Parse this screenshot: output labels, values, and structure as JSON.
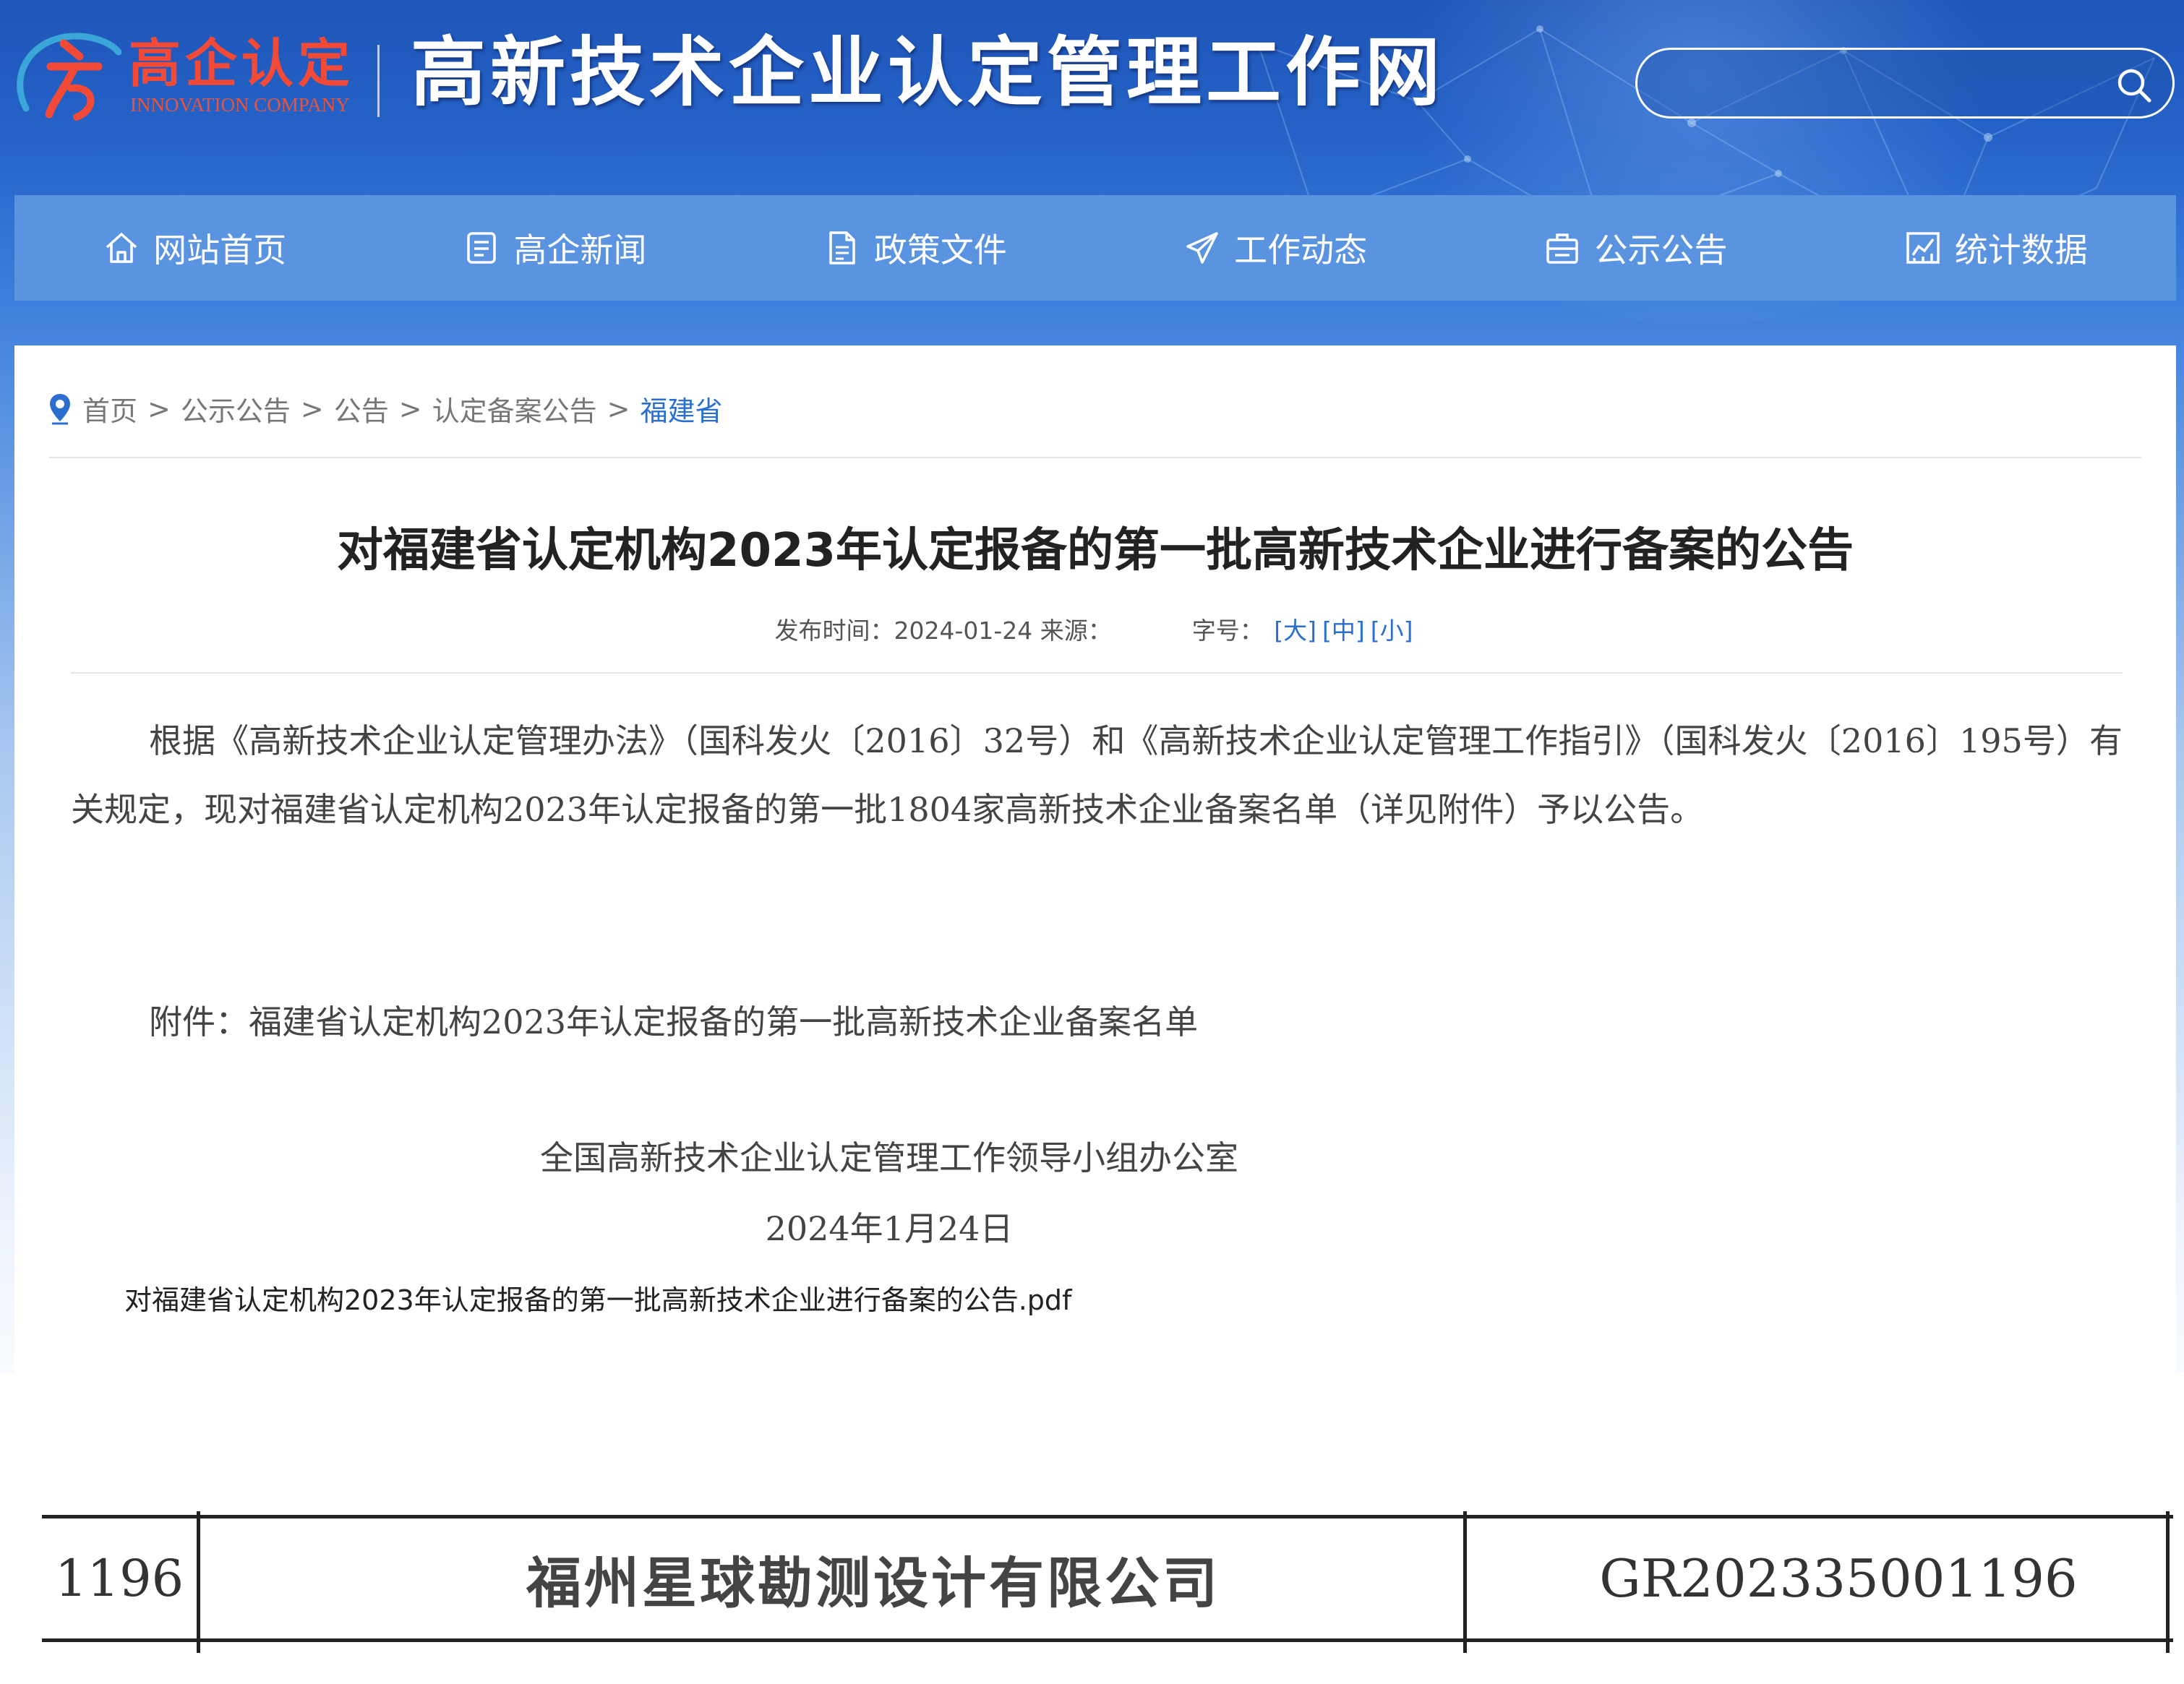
{
  "header": {
    "logo_cn": "高企认定",
    "logo_en": "INNOVATION COMPANY",
    "site_title": "高新技术企业认定管理工作网",
    "search": {
      "value": "",
      "placeholder": ""
    }
  },
  "nav": {
    "items": [
      {
        "label": "网站首页",
        "icon": "home-icon"
      },
      {
        "label": "高企新闻",
        "icon": "news-icon"
      },
      {
        "label": "政策文件",
        "icon": "document-icon"
      },
      {
        "label": "工作动态",
        "icon": "send-icon"
      },
      {
        "label": "公示公告",
        "icon": "briefcase-icon"
      },
      {
        "label": "统计数据",
        "icon": "chart-icon"
      }
    ]
  },
  "breadcrumb": {
    "items": [
      "首页",
      "公示公告",
      "公告",
      "认定备案公告"
    ],
    "current": "福建省",
    "separator": ">"
  },
  "article": {
    "title": "对福建省认定机构2023年认定报备的第一批高新技术企业进行备案的公告",
    "meta": {
      "publish_label": "发布时间：",
      "publish_date": "2024-01-24",
      "source_label": "来源：",
      "font_label": "字号：",
      "font_large": "[大]",
      "font_medium": "[中]",
      "font_small": "[小]"
    },
    "body": "根据《高新技术企业认定管理办法》（国科发火〔2016〕32号）和《高新技术企业认定管理工作指引》（国科发火〔2016〕195号）有关规定，现对福建省认定机构2023年认定报备的第一批1804家高新技术企业备案名单（详见附件）予以公告。",
    "attachment_line": "附件：福建省认定机构2023年认定报备的第一批高新技术企业备案名单",
    "signature_org": "全国高新技术企业认定管理工作领导小组办公室",
    "signature_date": "2024年1月24日",
    "pdf_link": "对福建省认定机构2023年认定报备的第一批高新技术企业进行备案的公告.pdf"
  },
  "table_row": {
    "number": "1196",
    "company": "福州星球勘测设计有限公司",
    "code": "GR202335001196"
  },
  "colors": {
    "nav_bg": "#5a93e0",
    "banner_top": "#1f55b8",
    "logo_red": "#f24a36",
    "link_blue": "#2a6fcf"
  }
}
